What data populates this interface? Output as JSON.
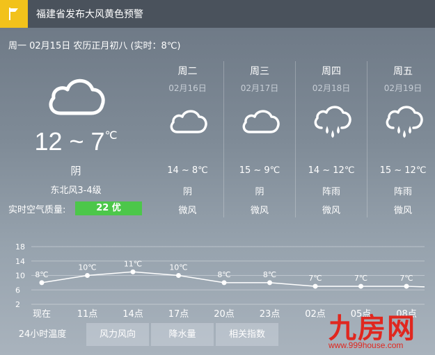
{
  "alert": {
    "text": "福建省发布大风黄色预警",
    "icon": "alert-flag-icon",
    "color": "#f2c21b"
  },
  "date_line": "周一  02月15日  农历正月初八  (实时：8℃)",
  "today": {
    "icon": "cloudy-icon",
    "temp_range": "12 ~ 7",
    "temp_unit": "℃",
    "condition": "阴",
    "wind": "东北风3-4级",
    "aqi_label": "实时空气质量:",
    "aqi_value": "22 优",
    "aqi_color": "#4cc74a"
  },
  "forecast": [
    {
      "day": "周二",
      "date": "02月16日",
      "icon": "cloudy-icon",
      "range": "14 ~ 8℃",
      "condition": "阴",
      "wind": "微风"
    },
    {
      "day": "周三",
      "date": "02月17日",
      "icon": "cloudy-icon",
      "range": "15 ~ 9℃",
      "condition": "阴",
      "wind": "微风"
    },
    {
      "day": "周四",
      "date": "02月18日",
      "icon": "shower-icon",
      "range": "14 ~ 12℃",
      "condition": "阵雨",
      "wind": "微风"
    },
    {
      "day": "周五",
      "date": "02月19日",
      "icon": "shower-icon",
      "range": "15 ~ 12℃",
      "condition": "阵雨",
      "wind": "微风"
    }
  ],
  "chart_data": {
    "type": "line",
    "categories": [
      "现在",
      "11点",
      "14点",
      "17点",
      "20点",
      "23点",
      "02点",
      "05点",
      "08点"
    ],
    "values": [
      8,
      10,
      11,
      10,
      8,
      8,
      7,
      7,
      7
    ],
    "point_labels": [
      "8℃",
      "10℃",
      "11℃",
      "10℃",
      "8℃",
      "8℃",
      "7℃",
      "7℃",
      "7℃"
    ],
    "yticks": [
      2,
      6,
      10,
      14,
      18
    ],
    "ylim": [
      2,
      18
    ],
    "grid": true
  },
  "tabs": [
    {
      "label": "24小时温度",
      "active": true
    },
    {
      "label": "风力风向",
      "active": false
    },
    {
      "label": "降水量",
      "active": false
    },
    {
      "label": "相关指数",
      "active": false
    }
  ],
  "watermark": {
    "brand": "九房网",
    "url": "www.999house.com",
    "color": "#e0271f"
  }
}
